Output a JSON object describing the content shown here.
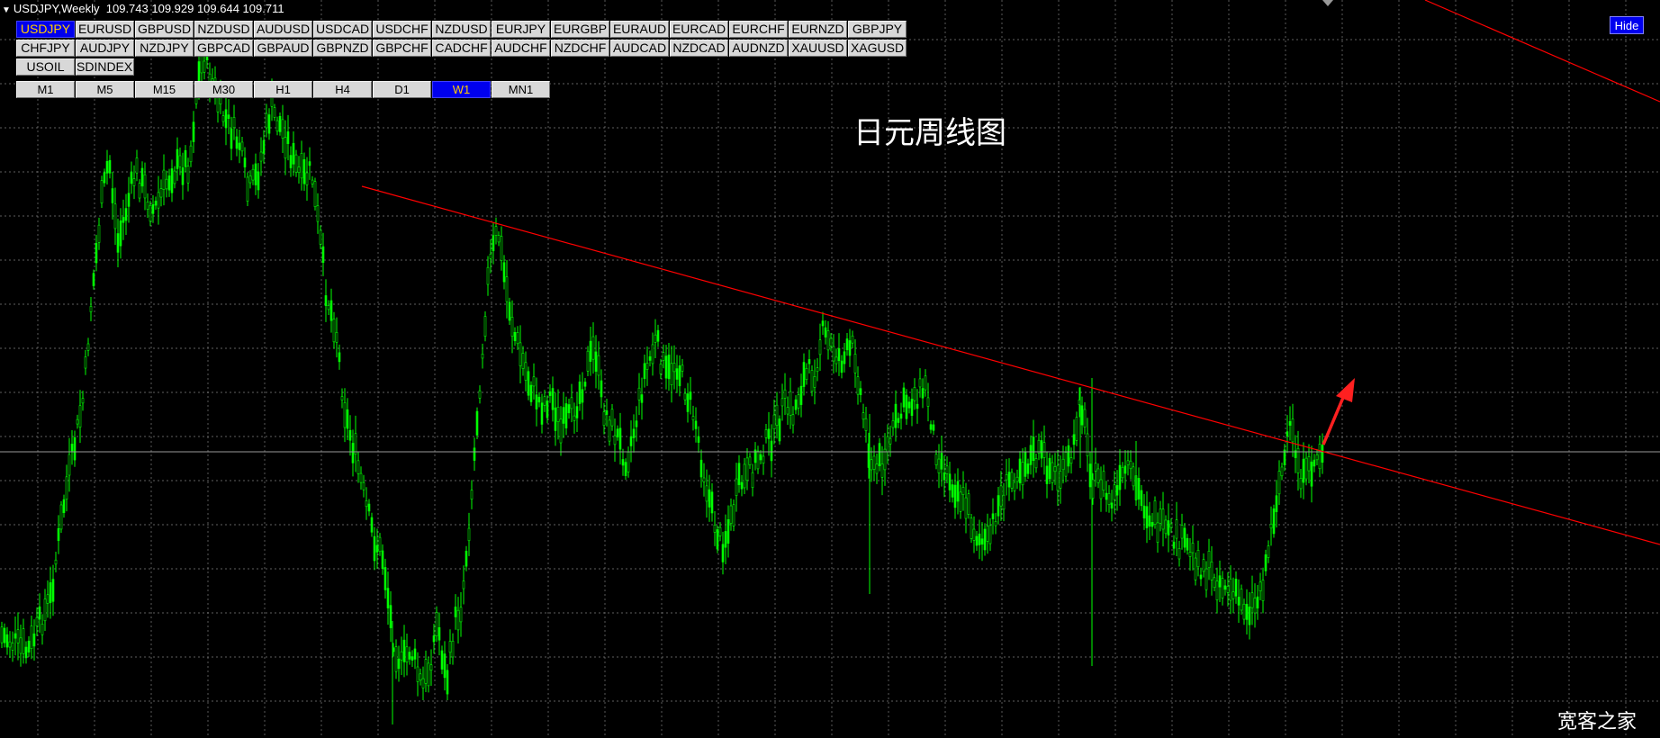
{
  "header": {
    "symbol_period": "USDJPY,Weekly",
    "ohlc": "109.743 109.929 109.644 109.711"
  },
  "symbols": [
    [
      "USDJPY",
      "EURUSD",
      "GBPUSD",
      "NZDUSD",
      "AUDUSD",
      "USDCAD",
      "USDCHF",
      "NZDUSD",
      "EURJPY",
      "EURGBP",
      "EURAUD",
      "EURCAD",
      "EURCHF",
      "EURNZD",
      "GBPJPY"
    ],
    [
      "CHFJPY",
      "AUDJPY",
      "NZDJPY",
      "GBPCAD",
      "GBPAUD",
      "GBPNZD",
      "GBPCHF",
      "CADCHF",
      "AUDCHF",
      "NZDCHF",
      "AUDCAD",
      "NZDCAD",
      "AUDNZD",
      "XAUUSD",
      "XAGUSD"
    ],
    [
      "USOIL",
      "SDINDEX."
    ]
  ],
  "active_symbol": "USDJPY",
  "timeframes": [
    "M1",
    "M5",
    "M15",
    "M30",
    "H1",
    "H4",
    "D1",
    "W1",
    "MN1"
  ],
  "active_timeframe": "W1",
  "hide_label": "Hide",
  "chart_title": "日元周线图",
  "watermark": "宽客之家",
  "colors": {
    "background": "#000000",
    "candle": "#00ff00",
    "trendline": "#ff0000",
    "grid": "#808080",
    "active_button": "#0000ee",
    "active_button_text": "#ffcc00"
  },
  "chart_data": {
    "type": "candlestick",
    "symbol": "USDJPY",
    "timeframe": "Weekly",
    "last_bar": {
      "open": 109.743,
      "high": 109.929,
      "low": 109.644,
      "close": 109.711
    },
    "current_price_line": 109.711,
    "trendlines": 2,
    "arrow_annotation": "up",
    "grid": true
  }
}
